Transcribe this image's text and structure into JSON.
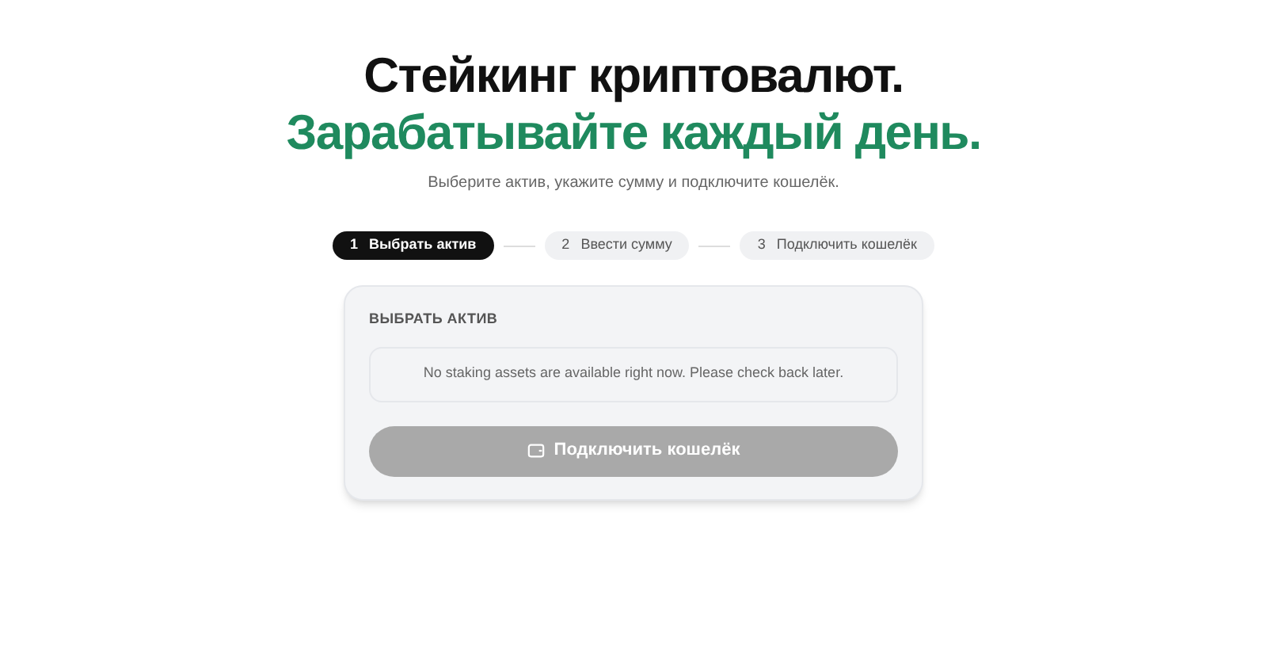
{
  "heading": {
    "line_1": "Стейкинг криптовалют.",
    "line_2": "Зарабатывайте каждый день."
  },
  "subtitle": "Выберите актив, укажите сумму и подключите кошелёк.",
  "steps": [
    {
      "number": "1",
      "label": "Выбрать актив",
      "selected": true
    },
    {
      "number": "2",
      "label": "Ввести сумму",
      "selected": false
    },
    {
      "number": "3",
      "label": "Подключить кошелёк",
      "selected": false
    }
  ],
  "card": {
    "section_label": "ВЫБРАТЬ АКТИВ",
    "empty_message": "No staking assets are available right now. Please check back later.",
    "connect_button": {
      "label": "Подключить кошелёк",
      "disabled": true
    }
  }
}
